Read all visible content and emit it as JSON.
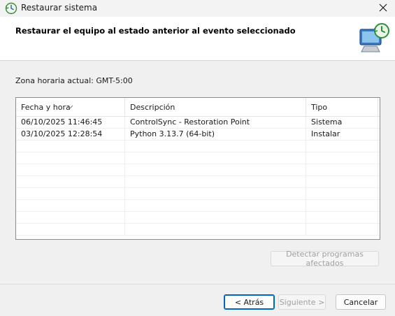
{
  "window": {
    "title": "Restaurar sistema",
    "app_icon": "system-restore-icon",
    "close_icon": "close-icon"
  },
  "header": {
    "title": "Restaurar el equipo al estado anterior al evento seleccionado",
    "graphic_icon": "restore-computer-icon"
  },
  "timezone_label": "Zona horaria actual: GMT-5:00",
  "table": {
    "columns": [
      "Fecha y hora",
      "Descripción",
      "Tipo"
    ],
    "sorted_column": "Fecha y hora",
    "rows": [
      {
        "date": "06/10/2025 11:46:45",
        "description": "ControlSync - Restoration Point",
        "type": "Sistema"
      },
      {
        "date": "03/10/2025 12:28:54",
        "description": "Python 3.13.7 (64-bit)",
        "type": "Instalar"
      }
    ]
  },
  "buttons": {
    "detect": "Detectar programas afectados",
    "back": "< Atrás",
    "next": "Siguiente >",
    "cancel": "Cancelar"
  },
  "colors": {
    "accent": "#0067c0",
    "header_bg": "#ffffff",
    "dialog_bg": "#f0f0f0"
  }
}
